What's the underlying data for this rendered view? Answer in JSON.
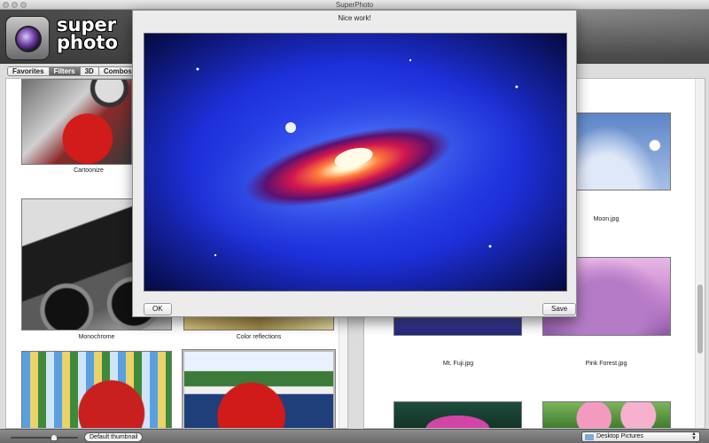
{
  "window": {
    "title": "SuperPhoto"
  },
  "logo": {
    "line1": "super",
    "line2": "photo"
  },
  "tabs": [
    {
      "label": "Favorites"
    },
    {
      "label": "Filters"
    },
    {
      "label": "3D"
    },
    {
      "label": "Combos"
    }
  ],
  "filters": [
    {
      "label": "Cartoonize"
    },
    {
      "label": "Monochrome"
    },
    {
      "label": "Color reflections"
    }
  ],
  "pictures": [
    {
      "label": "Moon.jpg"
    },
    {
      "label": "Mt. Fuji.jpg"
    },
    {
      "label": "Pink Forest.jpg"
    }
  ],
  "dialog": {
    "title": "Nice work!",
    "ok_label": "OK",
    "save_label": "Save"
  },
  "bottom": {
    "thumbnail_label": "Default thumbnail",
    "folder_label": "Desktop Pictures"
  },
  "colors": {
    "active_tab": "#6e6e6e",
    "header_dark": "#3a3a3a",
    "preview_blue": "#1d3bff"
  }
}
